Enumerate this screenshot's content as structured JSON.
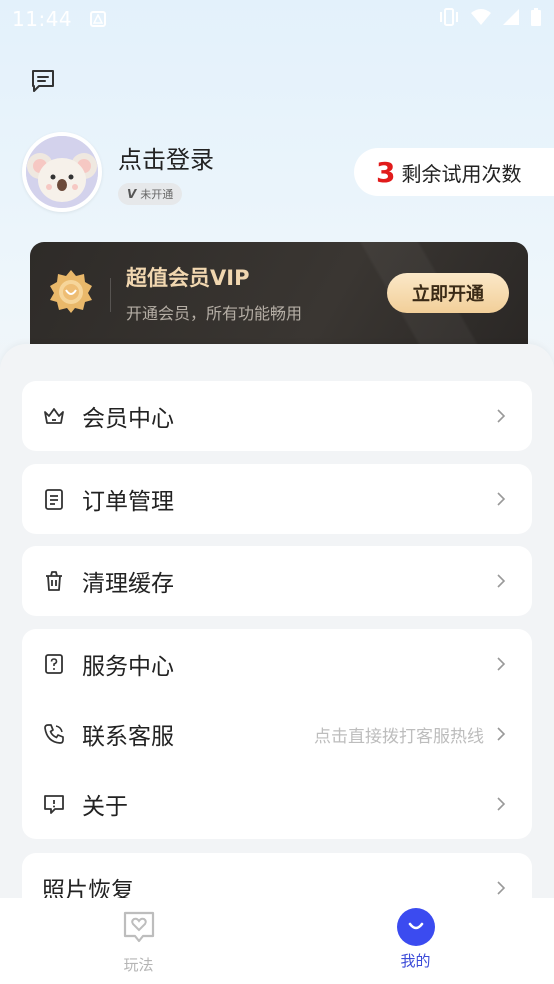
{
  "status_bar": {
    "time": "11:44"
  },
  "header": {
    "message_icon": "message-square-icon"
  },
  "profile": {
    "login_text": "点击登录",
    "vip_badge_prefix": "V",
    "vip_badge_text": "未开通",
    "trial_count": "3",
    "trial_label": "剩余试用次数"
  },
  "vip_card": {
    "title": "超值会员VIP",
    "subtitle": "开通会员，所有功能畅用",
    "button_label": "立即开通"
  },
  "menu": {
    "groups": [
      {
        "items": [
          {
            "icon": "crown-icon",
            "label": "会员中心",
            "hint": ""
          }
        ]
      },
      {
        "items": [
          {
            "icon": "order-list-icon",
            "label": "订单管理",
            "hint": ""
          }
        ]
      },
      {
        "items": [
          {
            "icon": "trash-icon",
            "label": "清理缓存",
            "hint": ""
          }
        ]
      },
      {
        "items": [
          {
            "icon": "help-icon",
            "label": "服务中心",
            "hint": ""
          },
          {
            "icon": "phone-icon",
            "label": "联系客服",
            "hint": "点击直接拨打客服热线"
          },
          {
            "icon": "info-chat-icon",
            "label": "关于",
            "hint": ""
          }
        ]
      },
      {
        "items": [
          {
            "icon": "photo-icon",
            "label": "照片恢复",
            "hint": ""
          }
        ]
      }
    ]
  },
  "tabbar": {
    "tabs": [
      {
        "label": "玩法",
        "icon": "heart-chat-icon",
        "active": false
      },
      {
        "label": "我的",
        "icon": "smile-icon",
        "active": true
      }
    ]
  },
  "colors": {
    "accent": "#3b4bf0",
    "trial_red": "#e11b1b",
    "vip_gold": "#f1d7b0"
  }
}
